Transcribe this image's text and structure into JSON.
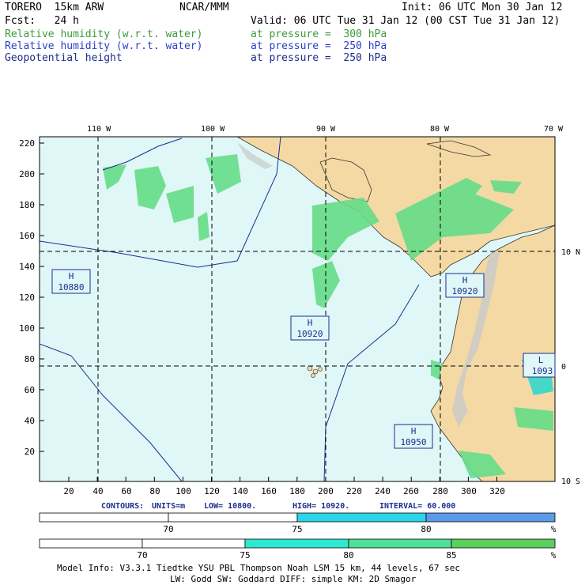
{
  "header": {
    "model": "TORERO  15km ARW",
    "center": "NCAR/MMM",
    "init": "Init: 06 UTC Mon 30 Jan 12",
    "fcst": "Fcst:   24 h",
    "valid": "Valid: 06 UTC Tue 31 Jan 12 (00 CST Tue 31 Jan 12)"
  },
  "fields": [
    {
      "name": "Relative humidity (w.r.t. water)",
      "level": "at pressure =  300 hPa",
      "color": "#3a9a3a"
    },
    {
      "name": "Relative humidity (w.r.t. water)",
      "level": "at pressure =  250 hPa",
      "color": "#2b3fc8"
    },
    {
      "name": "Geopotential height",
      "level": "at pressure =  250 hPa",
      "color": "#000000"
    }
  ],
  "map": {
    "lon_labels": [
      "110 W",
      "100 W",
      "90 W",
      "80 W",
      "70 W"
    ],
    "lat_labels": [
      "10 N",
      "0",
      "10 S"
    ],
    "y_ticks": [
      "220",
      "200",
      "180",
      "160",
      "140",
      "120",
      "100",
      "80",
      "60",
      "40",
      "20"
    ],
    "x_ticks": [
      "20",
      "40",
      "60",
      "80",
      "100",
      "120",
      "140",
      "160",
      "180",
      "200",
      "220",
      "240",
      "260",
      "280",
      "300",
      "320"
    ],
    "highs": [
      {
        "type": "H",
        "value": "10880"
      },
      {
        "type": "H",
        "value": "10920"
      },
      {
        "type": "H",
        "value": "10920"
      },
      {
        "type": "H",
        "value": "10950"
      },
      {
        "type": "L",
        "value": "1093"
      }
    ],
    "colors": {
      "ocean": "#dff7f7",
      "land": "#f5d9a4",
      "rh_green": "#66dd88",
      "rh_cyan": "#33d6cc",
      "rh_blue": "#5599ee"
    }
  },
  "contours": {
    "label": "CONTOURS:",
    "units": "UNITS=m",
    "low": "LOW=  10800.",
    "high": "HIGH=  10920.",
    "interval": "INTERVAL=   60.000"
  },
  "colorbar1": {
    "labels": [
      "70",
      "75",
      "80",
      "%"
    ],
    "colors": [
      "#ffffff",
      "#ffffff",
      "#2cd4e8",
      "#5b9ae8"
    ]
  },
  "colorbar2": {
    "labels": [
      "70",
      "75",
      "80",
      "85",
      "%"
    ],
    "colors": [
      "#ffffff",
      "#ffffff",
      "#2ee8d2",
      "#4fe09a",
      "#5dcf5d"
    ]
  },
  "footer": {
    "line1": "Model Info: V3.3.1   Tiedtke YSU PBL  Thompson   Noah LSM  15 km,   44 levels,   67 sec",
    "line2": "LW: Godd SW: Goddard DIFF: simple KM: 2D Smagor"
  }
}
